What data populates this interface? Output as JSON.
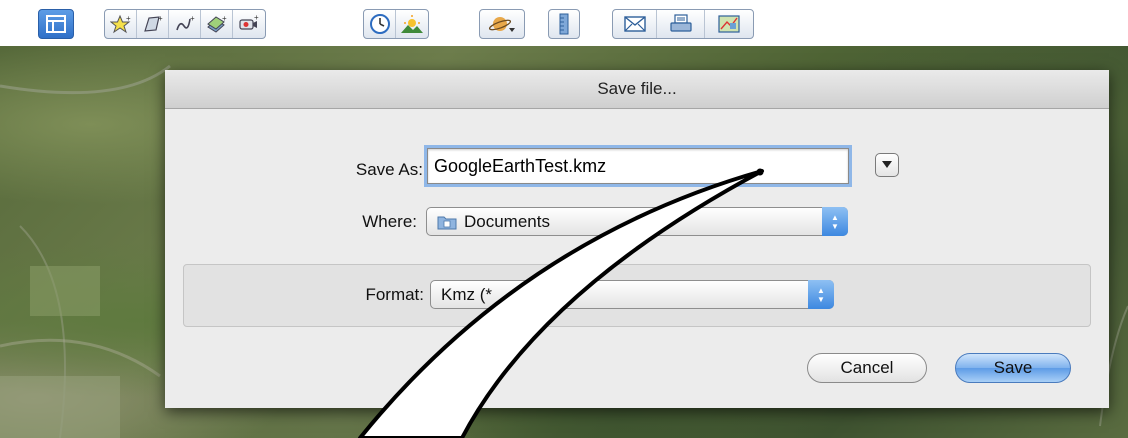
{
  "toolbar": {
    "buttons": [
      {
        "icon": "sidebar-icon"
      },
      {
        "icon": "add-placemark-icon"
      },
      {
        "icon": "add-polygon-icon"
      },
      {
        "icon": "add-path-icon"
      },
      {
        "icon": "add-image-overlay-icon"
      },
      {
        "icon": "record-tour-icon"
      },
      {
        "icon": "historical-imagery-icon"
      },
      {
        "icon": "sunlight-icon"
      },
      {
        "icon": "planet-icon"
      },
      {
        "icon": "ruler-icon"
      },
      {
        "icon": "email-icon"
      },
      {
        "icon": "print-icon"
      },
      {
        "icon": "view-in-maps-icon"
      }
    ]
  },
  "dialog": {
    "title": "Save file...",
    "save_as_label": "Save As:",
    "save_as_value": "GoogleEarthTest.kmz",
    "where_label": "Where:",
    "where_value": "Documents",
    "format_label": "Format:",
    "format_value": "Kmz (*",
    "cancel_label": "Cancel",
    "save_label": "Save"
  },
  "colors": {
    "accent": "#3d88e0",
    "focus_ring": "#8fb7e8",
    "toolbar_active": "#3b7fd4"
  }
}
